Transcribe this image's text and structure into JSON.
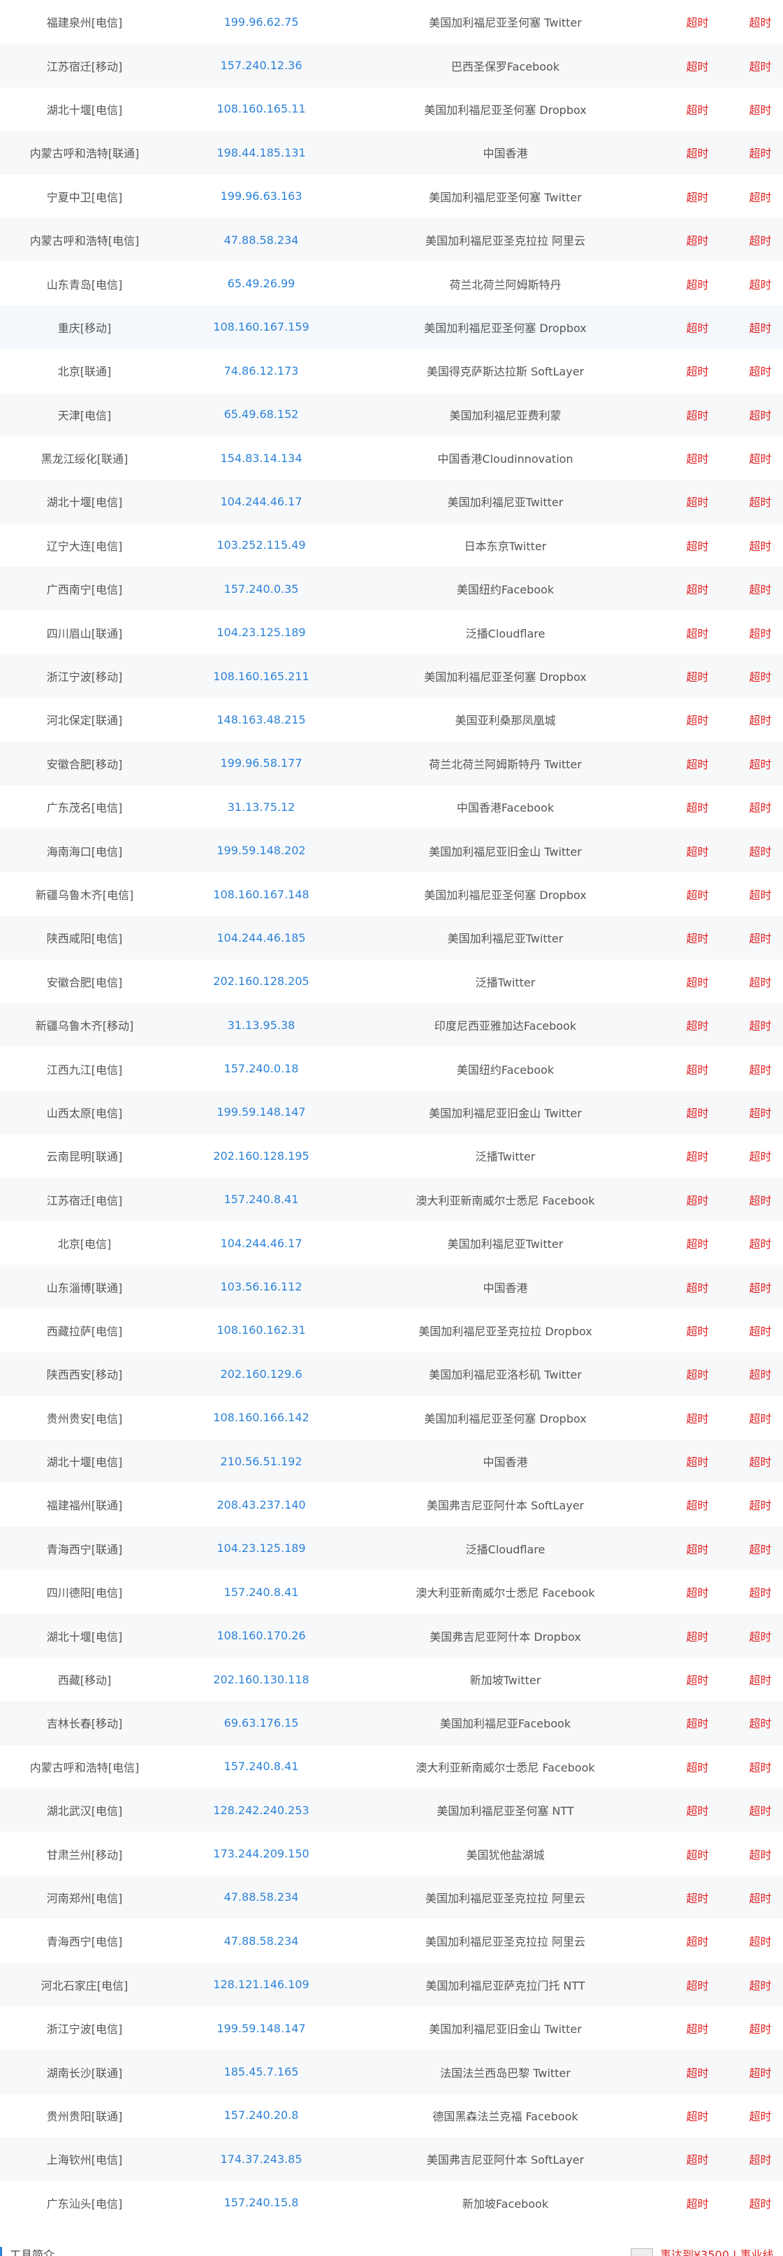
{
  "rows": [
    {
      "loc": "福建泉州[电信]",
      "ip": "199.96.62.75",
      "geo": "美国加利福尼亚圣何塞 Twitter",
      "s1": "超时",
      "s2": "超时"
    },
    {
      "loc": "江苏宿迁[移动]",
      "ip": "157.240.12.36",
      "geo": "巴西圣保罗Facebook",
      "s1": "超时",
      "s2": "超时"
    },
    {
      "loc": "湖北十堰[电信]",
      "ip": "108.160.165.11",
      "geo": "美国加利福尼亚圣何塞 Dropbox",
      "s1": "超时",
      "s2": "超时"
    },
    {
      "loc": "内蒙古呼和浩特[联通]",
      "ip": "198.44.185.131",
      "geo": "中国香港",
      "s1": "超时",
      "s2": "超时"
    },
    {
      "loc": "宁夏中卫[电信]",
      "ip": "199.96.63.163",
      "geo": "美国加利福尼亚圣何塞 Twitter",
      "s1": "超时",
      "s2": "超时"
    },
    {
      "loc": "内蒙古呼和浩特[电信]",
      "ip": "47.88.58.234",
      "geo": "美国加利福尼亚圣克拉拉 阿里云",
      "s1": "超时",
      "s2": "超时"
    },
    {
      "loc": "山东青岛[电信]",
      "ip": "65.49.26.99",
      "geo": "荷兰北荷兰阿姆斯特丹",
      "s1": "超时",
      "s2": "超时"
    },
    {
      "loc": "重庆[移动]",
      "ip": "108.160.167.159",
      "geo": "美国加利福尼亚圣何塞 Dropbox",
      "s1": "超时",
      "s2": "超时"
    },
    {
      "loc": "北京[联通]",
      "ip": "74.86.12.173",
      "geo": "美国得克萨斯达拉斯 SoftLayer",
      "s1": "超时",
      "s2": "超时"
    },
    {
      "loc": "天津[电信]",
      "ip": "65.49.68.152",
      "geo": "美国加利福尼亚费利蒙",
      "s1": "超时",
      "s2": "超时"
    },
    {
      "loc": "黑龙江绥化[联通]",
      "ip": "154.83.14.134",
      "geo": "中国香港Cloudinnovation",
      "s1": "超时",
      "s2": "超时"
    },
    {
      "loc": "湖北十堰[电信]",
      "ip": "104.244.46.17",
      "geo": "美国加利福尼亚Twitter",
      "s1": "超时",
      "s2": "超时"
    },
    {
      "loc": "辽宁大连[电信]",
      "ip": "103.252.115.49",
      "geo": "日本东京Twitter",
      "s1": "超时",
      "s2": "超时"
    },
    {
      "loc": "广西南宁[电信]",
      "ip": "157.240.0.35",
      "geo": "美国纽约Facebook",
      "s1": "超时",
      "s2": "超时"
    },
    {
      "loc": "四川眉山[联通]",
      "ip": "104.23.125.189",
      "geo": "泛播Cloudflare",
      "s1": "超时",
      "s2": "超时"
    },
    {
      "loc": "浙江宁波[移动]",
      "ip": "108.160.165.211",
      "geo": "美国加利福尼亚圣何塞 Dropbox",
      "s1": "超时",
      "s2": "超时"
    },
    {
      "loc": "河北保定[联通]",
      "ip": "148.163.48.215",
      "geo": "美国亚利桑那凤凰城",
      "s1": "超时",
      "s2": "超时"
    },
    {
      "loc": "安徽合肥[移动]",
      "ip": "199.96.58.177",
      "geo": "荷兰北荷兰阿姆斯特丹 Twitter",
      "s1": "超时",
      "s2": "超时"
    },
    {
      "loc": "广东茂名[电信]",
      "ip": "31.13.75.12",
      "geo": "中国香港Facebook",
      "s1": "超时",
      "s2": "超时"
    },
    {
      "loc": "海南海口[电信]",
      "ip": "199.59.148.202",
      "geo": "美国加利福尼亚旧金山 Twitter",
      "s1": "超时",
      "s2": "超时"
    },
    {
      "loc": "新疆乌鲁木齐[电信]",
      "ip": "108.160.167.148",
      "geo": "美国加利福尼亚圣何塞 Dropbox",
      "s1": "超时",
      "s2": "超时"
    },
    {
      "loc": "陕西咸阳[电信]",
      "ip": "104.244.46.185",
      "geo": "美国加利福尼亚Twitter",
      "s1": "超时",
      "s2": "超时"
    },
    {
      "loc": "安徽合肥[电信]",
      "ip": "202.160.128.205",
      "geo": "泛播Twitter",
      "s1": "超时",
      "s2": "超时"
    },
    {
      "loc": "新疆乌鲁木齐[移动]",
      "ip": "31.13.95.38",
      "geo": "印度尼西亚雅加达Facebook",
      "s1": "超时",
      "s2": "超时"
    },
    {
      "loc": "江西九江[电信]",
      "ip": "157.240.0.18",
      "geo": "美国纽约Facebook",
      "s1": "超时",
      "s2": "超时"
    },
    {
      "loc": "山西太原[电信]",
      "ip": "199.59.148.147",
      "geo": "美国加利福尼亚旧金山 Twitter",
      "s1": "超时",
      "s2": "超时"
    },
    {
      "loc": "云南昆明[联通]",
      "ip": "202.160.128.195",
      "geo": "泛播Twitter",
      "s1": "超时",
      "s2": "超时"
    },
    {
      "loc": "江苏宿迁[电信]",
      "ip": "157.240.8.41",
      "geo": "澳大利亚新南威尔士悉尼 Facebook",
      "s1": "超时",
      "s2": "超时"
    },
    {
      "loc": "北京[电信]",
      "ip": "104.244.46.17",
      "geo": "美国加利福尼亚Twitter",
      "s1": "超时",
      "s2": "超时"
    },
    {
      "loc": "山东淄博[联通]",
      "ip": "103.56.16.112",
      "geo": "中国香港",
      "s1": "超时",
      "s2": "超时"
    },
    {
      "loc": "西藏拉萨[电信]",
      "ip": "108.160.162.31",
      "geo": "美国加利福尼亚圣克拉拉 Dropbox",
      "s1": "超时",
      "s2": "超时"
    },
    {
      "loc": "陕西西安[移动]",
      "ip": "202.160.129.6",
      "geo": "美国加利福尼亚洛杉矶 Twitter",
      "s1": "超时",
      "s2": "超时"
    },
    {
      "loc": "贵州贵安[电信]",
      "ip": "108.160.166.142",
      "geo": "美国加利福尼亚圣何塞 Dropbox",
      "s1": "超时",
      "s2": "超时"
    },
    {
      "loc": "湖北十堰[电信]",
      "ip": "210.56.51.192",
      "geo": "中国香港",
      "s1": "超时",
      "s2": "超时"
    },
    {
      "loc": "福建福州[联通]",
      "ip": "208.43.237.140",
      "geo": "美国弗吉尼亚阿什本 SoftLayer",
      "s1": "超时",
      "s2": "超时"
    },
    {
      "loc": "青海西宁[联通]",
      "ip": "104.23.125.189",
      "geo": "泛播Cloudflare",
      "s1": "超时",
      "s2": "超时"
    },
    {
      "loc": "四川德阳[电信]",
      "ip": "157.240.8.41",
      "geo": "澳大利亚新南威尔士悉尼 Facebook",
      "s1": "超时",
      "s2": "超时"
    },
    {
      "loc": "湖北十堰[电信]",
      "ip": "108.160.170.26",
      "geo": "美国弗吉尼亚阿什本 Dropbox",
      "s1": "超时",
      "s2": "超时"
    },
    {
      "loc": "西藏[移动]",
      "ip": "202.160.130.118",
      "geo": "新加坡Twitter",
      "s1": "超时",
      "s2": "超时"
    },
    {
      "loc": "吉林长春[移动]",
      "ip": "69.63.176.15",
      "geo": "美国加利福尼亚Facebook",
      "s1": "超时",
      "s2": "超时"
    },
    {
      "loc": "内蒙古呼和浩特[电信]",
      "ip": "157.240.8.41",
      "geo": "澳大利亚新南威尔士悉尼 Facebook",
      "s1": "超时",
      "s2": "超时"
    },
    {
      "loc": "湖北武汉[电信]",
      "ip": "128.242.240.253",
      "geo": "美国加利福尼亚圣何塞 NTT",
      "s1": "超时",
      "s2": "超时"
    },
    {
      "loc": "甘肃兰州[移动]",
      "ip": "173.244.209.150",
      "geo": "美国犹他盐湖城",
      "s1": "超时",
      "s2": "超时"
    },
    {
      "loc": "河南郑州[电信]",
      "ip": "47.88.58.234",
      "geo": "美国加利福尼亚圣克拉拉 阿里云",
      "s1": "超时",
      "s2": "超时"
    },
    {
      "loc": "青海西宁[电信]",
      "ip": "47.88.58.234",
      "geo": "美国加利福尼亚圣克拉拉 阿里云",
      "s1": "超时",
      "s2": "超时"
    },
    {
      "loc": "河北石家庄[电信]",
      "ip": "128.121.146.109",
      "geo": "美国加利福尼亚萨克拉门托 NTT",
      "s1": "超时",
      "s2": "超时"
    },
    {
      "loc": "浙江宁波[电信]",
      "ip": "199.59.148.147",
      "geo": "美国加利福尼亚旧金山 Twitter",
      "s1": "超时",
      "s2": "超时"
    },
    {
      "loc": "湖南长沙[联通]",
      "ip": "185.45.7.165",
      "geo": "法国法兰西岛巴黎 Twitter",
      "s1": "超时",
      "s2": "超时"
    },
    {
      "loc": "贵州贵阳[联通]",
      "ip": "157.240.20.8",
      "geo": "德国黑森法兰克福 Facebook",
      "s1": "超时",
      "s2": "超时"
    },
    {
      "loc": "上海钦州[电信]",
      "ip": "174.37.243.85",
      "geo": "美国弗吉尼亚阿什本 SoftLayer",
      "s1": "超时",
      "s2": "超时"
    },
    {
      "loc": "广东汕头[电信]",
      "ip": "157.240.15.8",
      "geo": "新加坡Facebook",
      "s1": "超时",
      "s2": "超时"
    }
  ],
  "hover_row_index": 7,
  "footer": {
    "title": "工具简介",
    "promo": "事达到¥3500 | 事业线"
  }
}
